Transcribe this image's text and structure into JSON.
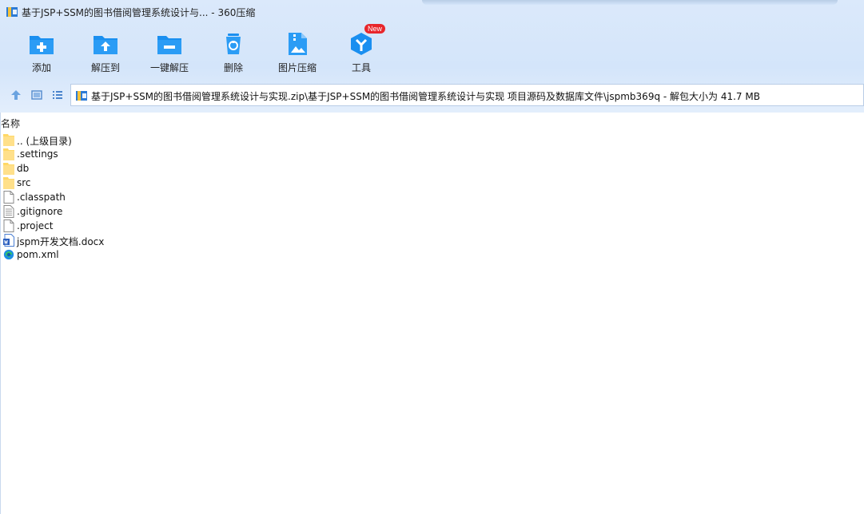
{
  "window": {
    "title": "基于JSP+SSM的图书借阅管理系统设计与... - 360压缩"
  },
  "toolbar": {
    "items": [
      {
        "label": "添加",
        "icon": "add-folder-icon"
      },
      {
        "label": "解压到",
        "icon": "extract-to-icon"
      },
      {
        "label": "一键解压",
        "icon": "one-click-extract-icon"
      },
      {
        "label": "删除",
        "icon": "delete-icon"
      },
      {
        "label": "图片压缩",
        "icon": "image-compress-icon"
      },
      {
        "label": "工具",
        "icon": "tools-icon",
        "badge": "New"
      }
    ]
  },
  "nav": {
    "address": "基于JSP+SSM的图书借阅管理系统设计与实现.zip\\基于JSP+SSM的图书借阅管理系统设计与实现 项目源码及数据库文件\\jspmb369q - 解包大小为 41.7 MB"
  },
  "list": {
    "column_name": "名称",
    "items": [
      {
        "name": ".. (上级目录)",
        "type": "folder"
      },
      {
        "name": ".settings",
        "type": "folder"
      },
      {
        "name": "db",
        "type": "folder"
      },
      {
        "name": "src",
        "type": "folder"
      },
      {
        "name": ".classpath",
        "type": "file"
      },
      {
        "name": ".gitignore",
        "type": "text"
      },
      {
        "name": ".project",
        "type": "file"
      },
      {
        "name": "jspm开发文档.docx",
        "type": "word"
      },
      {
        "name": "pom.xml",
        "type": "edge"
      }
    ]
  },
  "colors": {
    "accent": "#1a8ff0",
    "badge": "#e8262b",
    "folder": "#ffd866"
  }
}
